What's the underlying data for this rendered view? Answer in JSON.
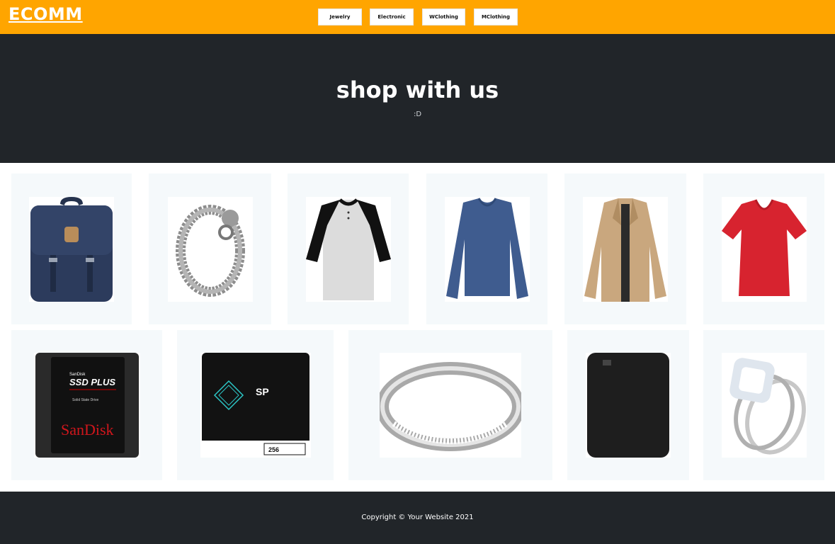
{
  "navbar": {
    "brand": "ECOMM",
    "links": [
      "Jewelry",
      "Electronic",
      "WClothing",
      "MClothing"
    ],
    "color": "#ffa500"
  },
  "hero": {
    "title": "shop with us",
    "subtitle": ":D",
    "color": "#212529"
  },
  "products": [
    {
      "icon": "backpack-icon"
    },
    {
      "icon": "bracelet-icon"
    },
    {
      "icon": "tshirt-raglan-icon"
    },
    {
      "icon": "longsleeve-shirt-icon"
    },
    {
      "icon": "jacket-icon"
    },
    {
      "icon": "red-tshirt-icon"
    },
    {
      "icon": "sandisk-ssd-icon",
      "text": [
        "SanDisk",
        "SSD PLUS",
        "Solid State Drive",
        "SanDisk"
      ]
    },
    {
      "icon": "sp-ssd-icon",
      "text": [
        "SP",
        "256"
      ]
    },
    {
      "icon": "silver-ring-icon"
    },
    {
      "icon": "external-hdd-icon"
    },
    {
      "icon": "diamond-ring-icon"
    }
  ],
  "footer": {
    "copyright": "Copyright © Your Website 2021"
  }
}
